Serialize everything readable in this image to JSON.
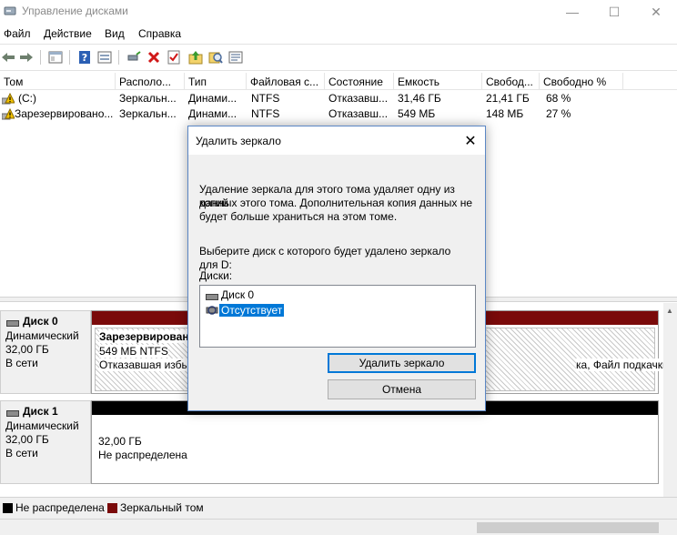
{
  "window": {
    "title": "Управление дисками",
    "controls": {
      "minimize": "—",
      "maximize": "☐",
      "close": "✕"
    }
  },
  "menu": [
    "Файл",
    "Действие",
    "Вид",
    "Справка"
  ],
  "toolbar": {
    "icons": [
      "back-icon",
      "forward-icon",
      "properties-icon",
      "help-icon",
      "view-icon",
      "connect-icon",
      "delete-icon",
      "check-icon",
      "import-icon",
      "search-icon",
      "list-icon"
    ],
    "colors": {
      "delete": "#d01818",
      "help": "#2b5fb4",
      "import": "#3a9b2f"
    }
  },
  "volume_table": {
    "columns": [
      "Том",
      "Располо...",
      "Тип",
      "Файловая с...",
      "Состояние",
      "Емкость",
      "Свобод...",
      "Свободно %"
    ],
    "rows": [
      [
        "(C:)",
        "Зеркальн...",
        "Динами...",
        "NTFS",
        "Отказавш...",
        "31,46 ГБ",
        "21,41 ГБ",
        "68 %"
      ],
      [
        "Зарезервировано...",
        "Зеркальн...",
        "Динами...",
        "NTFS",
        "Отказавш...",
        "549 МБ",
        "148 МБ",
        "27 %"
      ]
    ]
  },
  "disks": [
    {
      "name": "Диск 0",
      "type": "Динамический",
      "size": "32,00 ГБ",
      "status": "В сети",
      "volumes": [
        {
          "title": "Зарезервирован",
          "line1": "549 МБ NTFS",
          "line2": "Отказавшая избы"
        },
        {
          "line2": "ка, Файл подкачки)"
        }
      ]
    },
    {
      "name": "Диск 1",
      "type": "Динамический",
      "size": "32,00 ГБ",
      "status": "В сети",
      "volumes": [
        {
          "line1": "32,00 ГБ",
          "line2": "Не распределена"
        }
      ]
    }
  ],
  "legend": [
    {
      "label": "Не распределена",
      "color": "#000000"
    },
    {
      "label": "Зеркальный том",
      "color": "#7a0a0a"
    }
  ],
  "dialog": {
    "title": "Удалить зеркало",
    "description_lines": [
      "Удаление зеркала для этого тома удаляет одну из копий",
      "данных этого тома. Дополнительная копия данных не",
      "будет больше храниться на этом томе."
    ],
    "prompt": "Выберите диск с которого будет удалено зеркало для D:",
    "disks_label": "Диски:",
    "disk_list": [
      {
        "label": "Диск 0",
        "selected": false
      },
      {
        "label": "Отсутствует",
        "selected": true
      }
    ],
    "remove_button": "Удалить зеркало",
    "cancel_button": "Отмена",
    "close": "✕",
    "accent": "#0078d7"
  }
}
